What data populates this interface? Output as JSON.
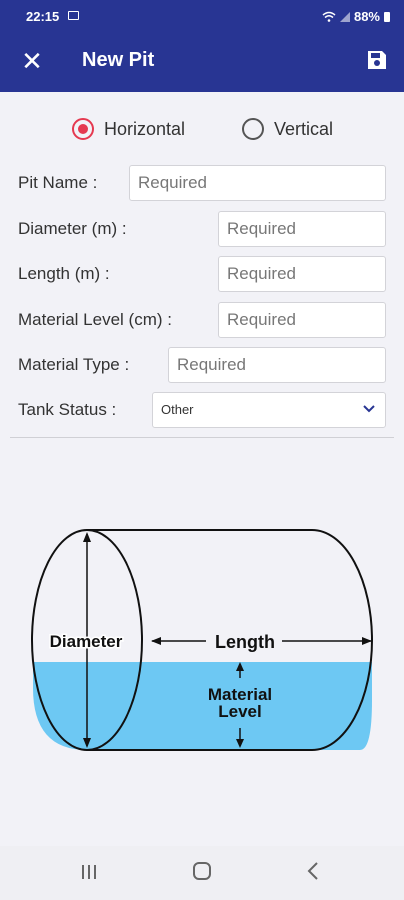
{
  "status_bar": {
    "time": "22:15",
    "battery": "88%"
  },
  "app_bar": {
    "title": "New Pit"
  },
  "orientation": {
    "options": [
      "Horizontal",
      "Vertical"
    ],
    "selected": "Horizontal"
  },
  "form": {
    "pit_name": {
      "label": "Pit Name :",
      "placeholder": "Required"
    },
    "diameter": {
      "label": "Diameter (m) :",
      "placeholder": "Required"
    },
    "length": {
      "label": "Length (m) :",
      "placeholder": "Required"
    },
    "material_level": {
      "label": "Material Level (cm) :",
      "placeholder": "Required"
    },
    "material_type": {
      "label": "Material Type :",
      "placeholder": "Required"
    },
    "tank_status": {
      "label": "Tank Status :",
      "value": "Other"
    }
  },
  "diagram": {
    "labels": {
      "diameter": "Diameter",
      "length": "Length",
      "material": "Material",
      "level": "Level"
    },
    "colors": {
      "liquid": "#6dc8f3",
      "outline": "#111111"
    }
  },
  "colors": {
    "primary": "#283593",
    "radio_accent": "#e53950",
    "background": "#f2f2f7"
  },
  "icons": [
    "close-icon",
    "save-icon",
    "chevron-down-icon",
    "recent-apps-icon",
    "home-icon",
    "back-icon",
    "wifi-icon",
    "signal-icon",
    "battery-icon",
    "gallery-icon"
  ]
}
